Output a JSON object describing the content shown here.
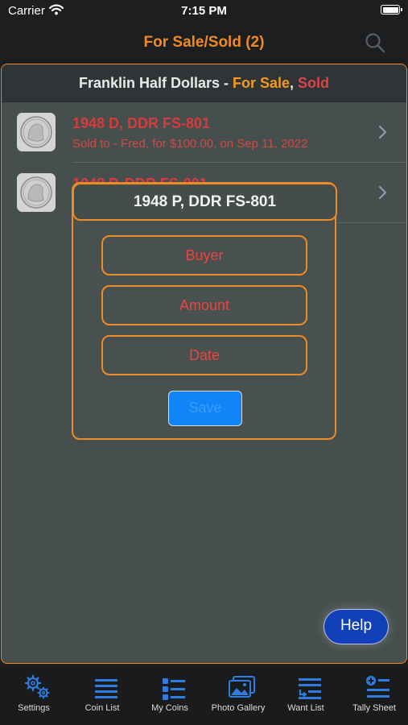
{
  "status_bar": {
    "carrier": "Carrier",
    "time": "7:15 PM"
  },
  "nav": {
    "title": "For Sale/Sold (2)",
    "search_icon": "search-icon"
  },
  "section_header": {
    "title": "Franklin Half Dollars",
    "separator": " - ",
    "for_sale": "For Sale",
    "separator2": ", ",
    "sold": "Sold"
  },
  "rows": [
    {
      "title": "1948 D, DDR FS-801",
      "subtitle": "Sold to - Fred, for $100.00, on Sep 11, 2022"
    },
    {
      "title": "1948 P, DDR FS-801",
      "subtitle": ""
    }
  ],
  "modal": {
    "title": "1948 P, DDR FS-801",
    "buyer_placeholder": "Buyer",
    "amount_placeholder": "Amount",
    "date_placeholder": "Date",
    "save_label": "Save"
  },
  "help_label": "Help",
  "tabs": [
    {
      "label": "Settings",
      "icon": "gears-icon"
    },
    {
      "label": "Coin List",
      "icon": "list-icon"
    },
    {
      "label": "My Coins",
      "icon": "bullet-list-icon"
    },
    {
      "label": "Photo Gallery",
      "icon": "photos-icon"
    },
    {
      "label": "Want List",
      "icon": "want-list-icon"
    },
    {
      "label": "Tally Sheet",
      "icon": "tally-sheet-icon"
    }
  ],
  "colors": {
    "accent": "#f08a24",
    "sold_red": "#d93b3b",
    "tab_blue": "#2f7de1",
    "save_blue": "#1185f8"
  }
}
